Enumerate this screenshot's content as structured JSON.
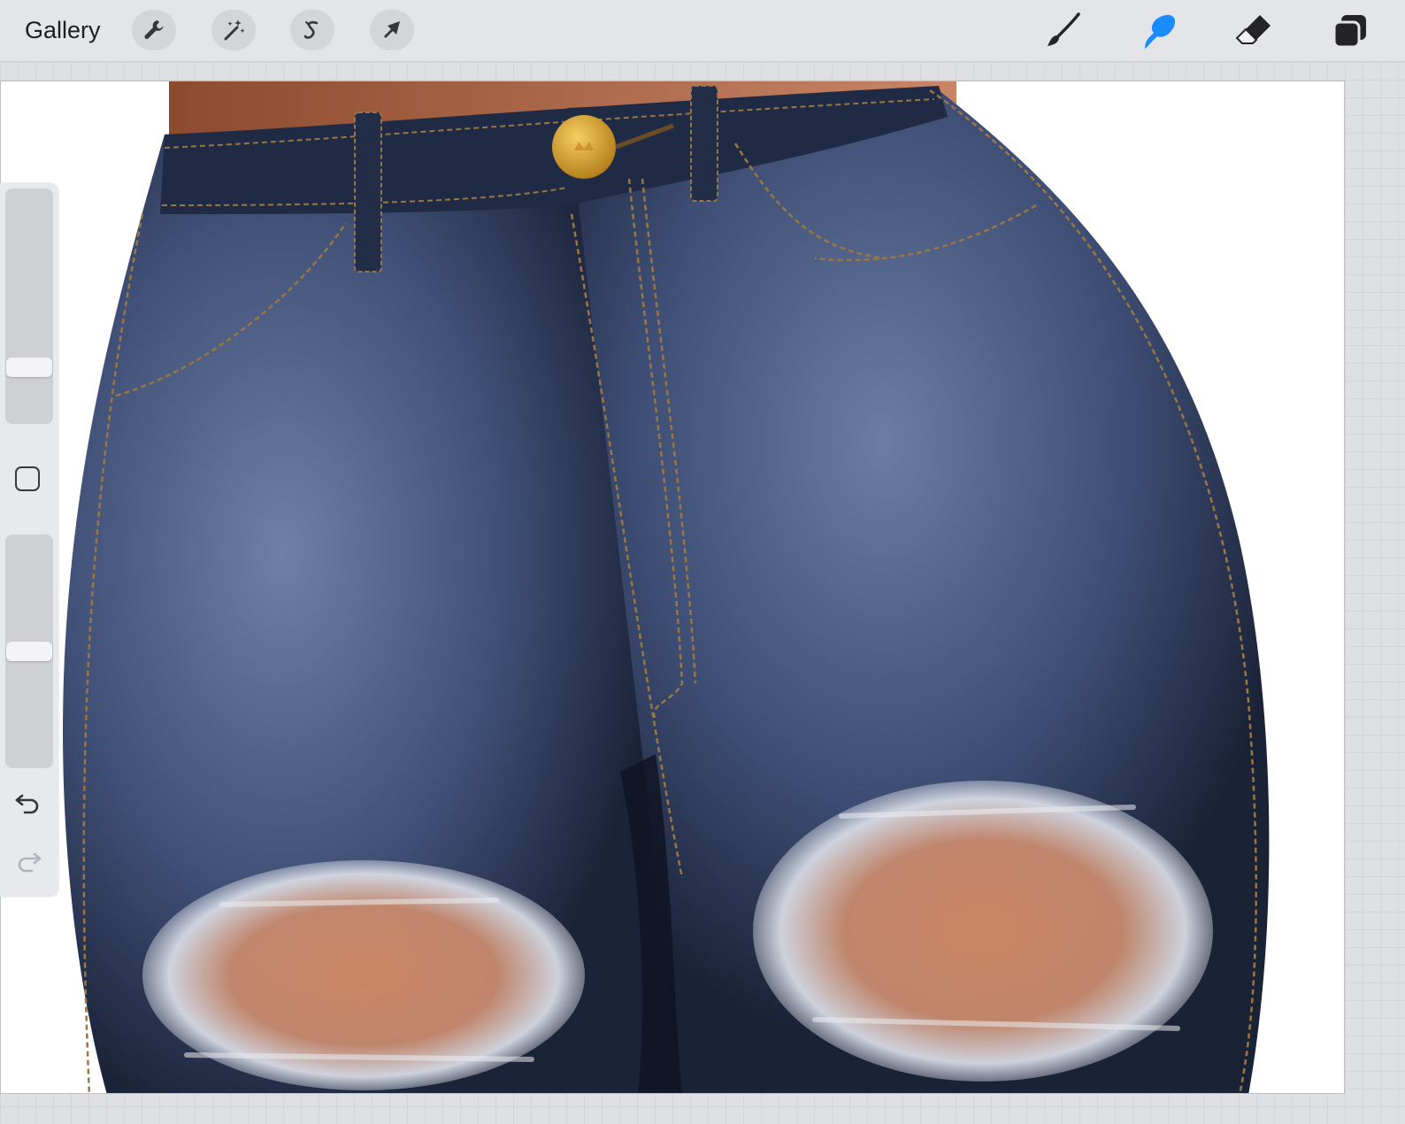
{
  "toolbar": {
    "gallery_label": "Gallery",
    "left_tools": [
      {
        "name": "actions",
        "icon": "wrench-icon"
      },
      {
        "name": "adjustments",
        "icon": "magic-wand-icon"
      },
      {
        "name": "selection",
        "icon": "selection-s-icon"
      },
      {
        "name": "transform",
        "icon": "arrow-cursor-icon"
      }
    ],
    "right_tools": [
      {
        "name": "brush",
        "icon": "brush-icon",
        "active": false
      },
      {
        "name": "smudge",
        "icon": "smudge-finger-icon",
        "active": true
      },
      {
        "name": "eraser",
        "icon": "eraser-icon",
        "active": false
      },
      {
        "name": "layers",
        "icon": "layers-icon",
        "active": false
      }
    ],
    "active_color": "#1a8cff"
  },
  "sidebar": {
    "brush_size_level": 0.75,
    "opacity_level": 0.5,
    "modify_icon": "square-icon",
    "undo_icon": "undo-arrow-icon",
    "redo_icon": "redo-arrow-icon",
    "redo_enabled": false
  },
  "canvas": {
    "subject": "denim",
    "colors": {
      "denim_dark": "#1c2438",
      "denim_mid": "#3a4a6e",
      "denim_light": "#6d7fa6",
      "stitch": "#a07c48",
      "skin": "#b36c4a",
      "button_gold": "#d8a431"
    }
  }
}
